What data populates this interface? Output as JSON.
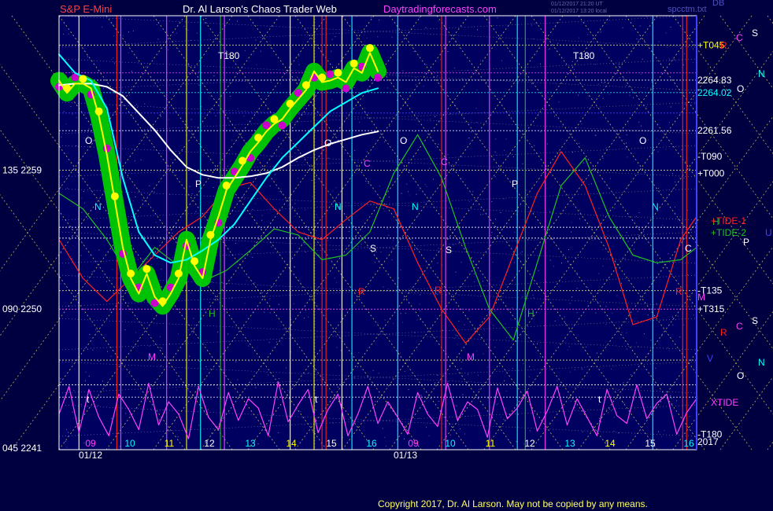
{
  "header": {
    "title_left": "S&P E-Mini",
    "title_center": "Dr. Al Larson's Chaos Trader Web",
    "title_right": "Daytradingforecasts.com",
    "corner_left": "01/12/2017 21:20 UT",
    "corner_right": "spcctm.txt",
    "corner_top_right": "DB",
    "stamp_line1": "01/12/2017 21:20 UT",
    "stamp_line2": "01/12/2017 13:20 local"
  },
  "footer": {
    "copyright": "Copyright 2017, Dr. Al Larson. May not be copied by any means."
  },
  "colors": {
    "background": "#000040",
    "plot_area": "#000060",
    "price": "#ffff00",
    "fast_ma": "#00ffff",
    "slow_ma": "#ffffff",
    "tide1": "#ff2020",
    "tide2": "#20c020",
    "xtide": "#ff40ff",
    "grid": "#ffff66",
    "band_green": "#00cc00",
    "band_magenta": "#cc00cc"
  },
  "chart_data": {
    "type": "line",
    "title": "S&P E-Mini",
    "left_axis_ticks": [
      {
        "label": "135  2259",
        "value": 2259
      },
      {
        "label": "090  2250",
        "value": 2250
      },
      {
        "label": "045  2241",
        "value": 2241
      }
    ],
    "right_axis_labels": [
      {
        "label": "+T045",
        "value": 2267.1,
        "color": "#ffff00"
      },
      {
        "label": "2264.83",
        "value": 2264.83,
        "color": "#ffffff"
      },
      {
        "label": "2264.02",
        "value": 2264.02,
        "color": "#00ffff"
      },
      {
        "label": "2261.56",
        "value": 2261.56,
        "color": "#ffffff"
      },
      {
        "label": "-T090",
        "value": 2259.9,
        "color": "#ffffff"
      },
      {
        "label": "+T000",
        "value": 2258.8,
        "color": "#ffffff"
      },
      {
        "label": "-T135",
        "value": 2251.2,
        "color": "#ffffff"
      },
      {
        "label": "+T315",
        "value": 2250.0,
        "color": "#ffffff"
      },
      {
        "label": "-T180",
        "value": 2241.9,
        "color": "#ffffff"
      }
    ],
    "right_letters": [
      {
        "label": "S",
        "x": 955,
        "y": 46,
        "color": "#ffffff"
      },
      {
        "label": "C",
        "x": 935,
        "y": 52,
        "color": "#ff40ff"
      },
      {
        "label": "R",
        "x": 915,
        "y": 62,
        "color": "#ff2020"
      },
      {
        "label": "N",
        "x": 963,
        "y": 98,
        "color": "#00ffff"
      },
      {
        "label": "O",
        "x": 936,
        "y": 117,
        "color": "#ffffff"
      },
      {
        "label": "H",
        "x": 905,
        "y": 286,
        "color": "#20c020"
      },
      {
        "label": "U",
        "x": 972,
        "y": 300,
        "color": "#4040ff"
      },
      {
        "label": "P",
        "x": 944,
        "y": 312,
        "color": "#ffffff"
      },
      {
        "label": "M",
        "x": 886,
        "y": 382,
        "color": "#ff40ff"
      },
      {
        "label": "S",
        "x": 955,
        "y": 412,
        "color": "#ffffff"
      },
      {
        "label": "C",
        "x": 935,
        "y": 419,
        "color": "#ff40ff"
      },
      {
        "label": "R",
        "x": 915,
        "y": 427,
        "color": "#ff2020"
      },
      {
        "label": "V",
        "x": 898,
        "y": 460,
        "color": "#4040ff"
      },
      {
        "label": "N",
        "x": 963,
        "y": 465,
        "color": "#00ffff"
      },
      {
        "label": "O",
        "x": 936,
        "y": 482,
        "color": "#ffffff"
      }
    ],
    "tide_labels": [
      {
        "label": "+TIDE-1",
        "color": "#ff2020"
      },
      {
        "label": "+TIDE-2",
        "color": "#20c020"
      },
      {
        "label": "XTIDE",
        "color": "#ff40ff"
      }
    ],
    "date_labels": [
      "01/12",
      "01/13"
    ],
    "date_label_x": [
      100,
      500
    ],
    "hour_labels": [
      "09",
      "10",
      "11",
      "12",
      "13",
      "14",
      "15",
      "16",
      "09",
      "10",
      "11",
      "12",
      "13",
      "14",
      "15",
      "16"
    ],
    "hour_label_x": [
      115,
      165,
      215,
      266,
      318,
      370,
      421,
      472,
      525,
      572,
      623,
      673,
      724,
      775,
      826,
      875
    ],
    "hour_label_colors": [
      "#ff40ff",
      "#00ffff",
      "#ffff00",
      "#ffffff",
      "#00ffff",
      "#ffff00",
      "#ffffff",
      "#00ffff",
      "#ff40ff",
      "#00ffff",
      "#ffff00",
      "#ffffff",
      "#00ffff",
      "#ffff00",
      "#ffffff",
      "#00ffff"
    ],
    "top_t180_labels": [
      {
        "label": "T180",
        "x": 277
      },
      {
        "label": "T180",
        "x": 728
      }
    ],
    "bottom_right_value": "2017",
    "planet_letters": [
      {
        "label": "O",
        "x": 108,
        "y": 183,
        "color": "#ffffff"
      },
      {
        "label": "N",
        "x": 120,
        "y": 267,
        "color": "#00ffff"
      },
      {
        "label": "M",
        "x": 188,
        "y": 458,
        "color": "#ff40ff"
      },
      {
        "label": "P",
        "x": 248,
        "y": 238,
        "color": "#ffffff"
      },
      {
        "label": "H",
        "x": 265,
        "y": 403,
        "color": "#20c020"
      },
      {
        "label": "O",
        "x": 412,
        "y": 186,
        "color": "#ffffff"
      },
      {
        "label": "N",
        "x": 425,
        "y": 267,
        "color": "#00ffff"
      },
      {
        "label": "C",
        "x": 462,
        "y": 212,
        "color": "#ff40ff"
      },
      {
        "label": "S",
        "x": 470,
        "y": 320,
        "color": "#ffffff"
      },
      {
        "label": "R",
        "x": 455,
        "y": 375,
        "color": "#ff2020"
      },
      {
        "label": "O",
        "x": 508,
        "y": 183,
        "color": "#ffffff"
      },
      {
        "label": "N",
        "x": 523,
        "y": 267,
        "color": "#00ffff"
      },
      {
        "label": "C",
        "x": 560,
        "y": 210,
        "color": "#ff40ff"
      },
      {
        "label": "S",
        "x": 566,
        "y": 322,
        "color": "#ffffff"
      },
      {
        "label": "R",
        "x": 552,
        "y": 373,
        "color": "#ff2020"
      },
      {
        "label": "M",
        "x": 593,
        "y": 458,
        "color": "#ff40ff"
      },
      {
        "label": "P",
        "x": 650,
        "y": 238,
        "color": "#ffffff"
      },
      {
        "label": "H",
        "x": 670,
        "y": 403,
        "color": "#20c020"
      },
      {
        "label": "O",
        "x": 812,
        "y": 183,
        "color": "#ffffff"
      },
      {
        "label": "N",
        "x": 828,
        "y": 267,
        "color": "#00ffff"
      },
      {
        "label": "C",
        "x": 870,
        "y": 320,
        "color": "#ffffff"
      },
      {
        "label": "R",
        "x": 858,
        "y": 375,
        "color": "#ff2020"
      },
      {
        "label": "t",
        "x": 110,
        "y": 512,
        "color": "#ffffff"
      },
      {
        "label": "t",
        "x": 400,
        "y": 512,
        "color": "#ffffff"
      },
      {
        "label": "t",
        "x": 760,
        "y": 512,
        "color": "#ffffff"
      }
    ],
    "price": {
      "x": [
        0,
        0.2,
        0.4,
        0.6,
        0.8,
        1.0,
        1.2,
        1.4,
        1.6,
        1.8,
        2.0,
        2.2,
        2.4,
        2.6,
        2.8,
        3.0,
        3.2,
        3.4,
        3.6,
        3.8,
        4.0,
        4.2,
        4.4,
        4.6,
        4.8,
        5.0,
        5.2,
        5.4,
        5.6,
        5.8,
        6.0,
        6.2,
        6.4,
        6.6,
        6.8,
        7.0,
        7.2,
        7.4,
        7.6,
        7.8,
        8.0
      ],
      "y": [
        2264.8,
        2264.0,
        2264.6,
        2264.6,
        2264.3,
        2262.5,
        2260.0,
        2257.0,
        2254.0,
        2252.0,
        2251.0,
        2252.3,
        2250.8,
        2250.2,
        2251.0,
        2252.0,
        2254.5,
        2252.8,
        2252.0,
        2254.5,
        2256.0,
        2257.7,
        2258.5,
        2259.3,
        2260.2,
        2260.8,
        2261.5,
        2262.0,
        2262.3,
        2263.0,
        2263.6,
        2264.2,
        2265.4,
        2264.7,
        2264.8,
        2265.0,
        2264.7,
        2265.6,
        2265.3,
        2266.6,
        2265.4
      ]
    },
    "fast_ma": {
      "x": [
        0,
        0.4,
        0.8,
        1.2,
        1.6,
        2.0,
        2.4,
        2.8,
        3.2,
        3.6,
        4.0,
        4.4,
        4.8,
        5.2,
        5.6,
        6.0,
        6.4,
        6.8,
        7.2,
        7.6,
        8.0
      ],
      "y": [
        2266.5,
        2265.3,
        2264.8,
        2263.0,
        2258.5,
        2255.0,
        2253.5,
        2253.0,
        2253.2,
        2253.8,
        2254.5,
        2255.5,
        2257.0,
        2258.5,
        2259.8,
        2260.8,
        2261.8,
        2262.8,
        2263.4,
        2264.0,
        2264.3
      ]
    },
    "slow_ma": {
      "x": [
        0,
        0.4,
        0.8,
        1.2,
        1.6,
        2.0,
        2.4,
        2.8,
        3.2,
        3.6,
        4.0,
        4.4,
        4.8,
        5.2,
        5.6,
        6.0,
        6.4,
        6.8,
        7.2,
        7.6,
        8.0
      ],
      "y": [
        2264.5,
        2264.6,
        2264.6,
        2264.4,
        2263.8,
        2262.7,
        2261.6,
        2260.3,
        2259.2,
        2258.7,
        2258.5,
        2258.5,
        2258.6,
        2258.8,
        2259.2,
        2259.8,
        2260.3,
        2260.7,
        2261.0,
        2261.3,
        2261.5
      ]
    },
    "tide1": {
      "x": [
        0,
        0.6,
        1.2,
        1.8,
        2.4,
        3.0,
        3.6,
        4.2,
        4.8,
        5.4,
        6.0,
        6.6,
        7.2,
        7.8,
        8.4,
        9.0,
        9.6,
        10.2,
        10.8,
        11.4,
        12.0,
        12.6,
        13.2,
        13.8,
        14.4,
        15.0,
        15.6,
        16.0
      ],
      "y": [
        2254.5,
        2252.0,
        2250.5,
        2252.0,
        2253.5,
        2255.0,
        2256.0,
        2257.8,
        2258.2,
        2256.5,
        2255.0,
        2254.5,
        2255.8,
        2257.0,
        2256.5,
        2253.0,
        2250.0,
        2247.8,
        2249.5,
        2253.5,
        2257.5,
        2260.2,
        2258.0,
        2254.0,
        2249.0,
        2249.5,
        2254.5,
        2256.0
      ]
    },
    "tide2": {
      "x": [
        0,
        0.6,
        1.2,
        1.8,
        2.4,
        3.0,
        3.6,
        4.2,
        4.8,
        5.4,
        6.0,
        6.6,
        7.2,
        7.8,
        8.4,
        9.0,
        9.6,
        10.2,
        10.8,
        11.4,
        12.0,
        12.6,
        13.2,
        13.8,
        14.4,
        15.0,
        15.6,
        16.0
      ],
      "y": [
        2257.5,
        2256.5,
        2254.5,
        2252.0,
        2254.0,
        2252.8,
        2251.8,
        2252.5,
        2253.8,
        2255.2,
        2254.8,
        2253.2,
        2253.5,
        2255.0,
        2258.8,
        2261.3,
        2258.5,
        2254.0,
        2250.0,
        2248.0,
        2253.0,
        2258.0,
        2259.8,
        2256.0,
        2253.5,
        2253.0,
        2253.2,
        2254.0
      ]
    },
    "xtide": {
      "x": [
        0,
        0.25,
        0.5,
        0.75,
        1.0,
        1.25,
        1.5,
        1.75,
        2.0,
        2.25,
        2.5,
        2.75,
        3.0,
        3.25,
        3.5,
        3.75,
        4.0,
        4.25,
        4.5,
        4.75,
        5.0,
        5.25,
        5.5,
        5.75,
        6.0,
        6.25,
        6.5,
        6.75,
        7.0,
        7.25,
        7.5,
        7.75,
        8.0,
        8.25,
        8.5,
        8.75,
        9.0,
        9.25,
        9.5,
        9.75,
        10.0,
        10.25,
        10.5,
        10.75,
        11.0,
        11.25,
        11.5,
        11.75,
        12.0,
        12.25,
        12.5,
        12.75,
        13.0,
        13.25,
        13.5,
        13.75,
        14.0,
        14.25,
        14.5,
        14.75,
        15.0,
        15.25,
        15.5,
        15.75,
        16.0
      ],
      "y": [
        2243.2,
        2245.0,
        2242.0,
        2244.8,
        2243.0,
        2241.8,
        2244.5,
        2243.5,
        2242.2,
        2245.2,
        2242.5,
        2244.0,
        2243.2,
        2241.6,
        2245.0,
        2243.0,
        2242.2,
        2244.6,
        2242.8,
        2244.2,
        2243.6,
        2241.8,
        2245.3,
        2242.7,
        2243.8,
        2244.8,
        2242.0,
        2243.5,
        2244.5,
        2241.8,
        2243.2,
        2245.0,
        2242.6,
        2244.0,
        2243.0,
        2241.9,
        2244.6,
        2243.2,
        2242.4,
        2245.2,
        2242.8,
        2244.0,
        2243.5,
        2241.7,
        2244.9,
        2242.9,
        2243.6,
        2244.7,
        2242.1,
        2243.4,
        2245.0,
        2242.5,
        2244.2,
        2243.0,
        2241.8,
        2244.8,
        2243.1,
        2242.6,
        2245.1,
        2242.9,
        2243.9,
        2244.5,
        2241.9,
        2243.3,
        2244.2
      ]
    },
    "vlines": [
      {
        "x": 0.5,
        "color": "#ffffff"
      },
      {
        "x": 1.45,
        "color": "#ff2020"
      },
      {
        "x": 1.55,
        "color": "#ff40ff"
      },
      {
        "x": 2.7,
        "color": "#ff40ff"
      },
      {
        "x": 3.2,
        "color": "#ffff00"
      },
      {
        "x": 3.55,
        "color": "#00ffff"
      },
      {
        "x": 4.05,
        "color": "#20c020"
      },
      {
        "x": 4.15,
        "color": "#ff40ff"
      },
      {
        "x": 5.8,
        "color": "#ffffff"
      },
      {
        "x": 6.4,
        "color": "#ffff00"
      },
      {
        "x": 6.6,
        "color": "#ff2020"
      },
      {
        "x": 6.7,
        "color": "#ff2020"
      },
      {
        "x": 7.1,
        "color": "#ffffff"
      },
      {
        "x": 7.35,
        "color": "#00ffff"
      },
      {
        "x": 8.5,
        "color": "#00ffff"
      },
      {
        "x": 9.6,
        "color": "#ff2020"
      },
      {
        "x": 9.7,
        "color": "#ff40ff"
      },
      {
        "x": 10.8,
        "color": "#ff40ff"
      },
      {
        "x": 11.5,
        "color": "#00ffff"
      },
      {
        "x": 11.7,
        "color": "#20c020"
      },
      {
        "x": 12.2,
        "color": "#ff40ff"
      },
      {
        "x": 14.9,
        "color": "#00ffff"
      },
      {
        "x": 15.65,
        "color": "#ff2020"
      },
      {
        "x": 15.75,
        "color": "#ff2020"
      }
    ],
    "hlines": [
      {
        "y": 2267.1,
        "color": "#ffff66"
      },
      {
        "y": 2265.3,
        "color": "#ff40ff"
      },
      {
        "y": 2264.83,
        "color": "#ffffff"
      },
      {
        "y": 2264.02,
        "color": "#00ffff"
      },
      {
        "y": 2262.7,
        "color": "#4040ff"
      },
      {
        "y": 2261.56,
        "color": "#ffffff"
      },
      {
        "y": 2259.0,
        "color": "#ffff66"
      },
      {
        "y": 2255.3,
        "color": "#ffffff"
      },
      {
        "y": 2254.6,
        "color": "#ffffff"
      },
      {
        "y": 2251.2,
        "color": "#ffff66"
      },
      {
        "y": 2250.0,
        "color": "#ff40ff"
      },
      {
        "y": 2246.7,
        "color": "#ffff66"
      },
      {
        "y": 2245.1,
        "color": "#ffffff"
      },
      {
        "y": 2244.3,
        "color": "#ffffff"
      }
    ],
    "x_range": [
      0,
      16
    ],
    "y_range": [
      2240.9,
      2269.0
    ],
    "grid": true,
    "legend": "none"
  }
}
